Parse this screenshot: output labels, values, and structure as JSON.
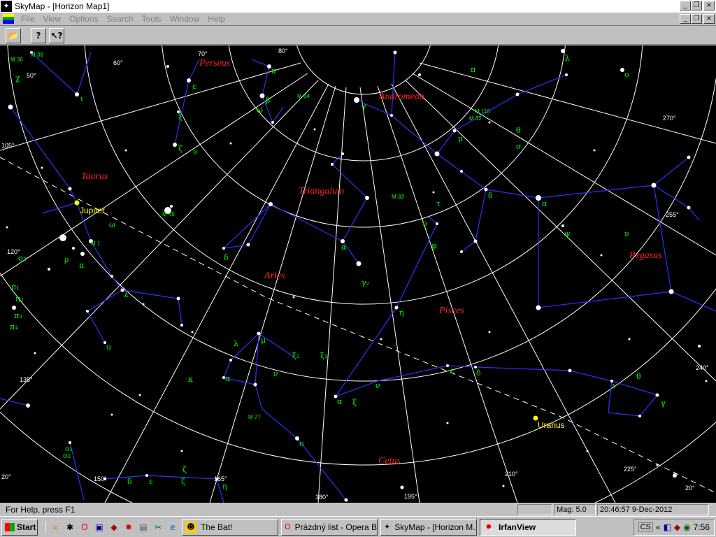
{
  "window": {
    "title": "SkyMap - [Horizon Map1]",
    "minimize": "_",
    "restore": "❐",
    "close": "×",
    "doc_minimize": "_",
    "doc_restore": "❐",
    "doc_close": "×"
  },
  "menu": {
    "items": [
      "File",
      "View",
      "Options",
      "Search",
      "Tools",
      "Window",
      "Help"
    ]
  },
  "toolbar": {
    "open_glyph": "📂",
    "help_glyph": "?",
    "context_help_glyph": "↖?"
  },
  "map": {
    "constellations": [
      "Perseus",
      "Andromeda",
      "Taurus",
      "Triangulum",
      "Aries",
      "Pisces",
      "Pegasus",
      "Cetus"
    ],
    "planets": [
      "Jupiter",
      "Uranus"
    ],
    "degree_labels": [
      "70°",
      "80°",
      "60°",
      "50°",
      "105°",
      "270°",
      "255°",
      "120°",
      "135°",
      "240°",
      "150°",
      "165°",
      "180°",
      "195°",
      "210°",
      "225°",
      "20°",
      "20°"
    ],
    "greek_labels": [
      "χ",
      "ι",
      "ε",
      "ξ",
      "ζ",
      "ο",
      "κ",
      "β",
      "ω",
      "γ",
      "π",
      "θ",
      "σ",
      "μ",
      "δ",
      "α",
      "λ",
      "ν",
      "τ",
      "φ",
      "υ",
      "η",
      "ψ",
      "ι",
      "ο",
      "θ",
      "γ",
      "ε",
      "δ",
      "ν",
      "ξ",
      "ζ",
      "ρ",
      "π",
      "σ₂",
      "α",
      "ν",
      "ξ₂",
      "ξ₁",
      "κ",
      "δ",
      "λ",
      "μ",
      "ο",
      "α",
      "π₁",
      "π₂",
      "π₃",
      "π₄",
      "ο₁",
      "ο₂",
      "γ₂",
      "ω",
      "α",
      "υ",
      "δ",
      "ε",
      "ζ",
      "η",
      "λ"
    ],
    "messier": [
      "M 36",
      "M 38",
      "M 34",
      "M 110",
      "M 32",
      "M 33",
      "M 45",
      "M 1",
      "M 77"
    ]
  },
  "status": {
    "help": "For Help, press F1",
    "blank": "",
    "mag": "Mag: 5.0",
    "datetime": "20:46:57 9-Dec-2012"
  },
  "taskbar": {
    "start": "Start",
    "tasks": [
      "The Bat!",
      "Prázdný list - Opera B...",
      "SkyMap - [Horizon M...",
      "IrfanView"
    ],
    "tray_cs": "CS",
    "tray_chevron": "«",
    "clock": "7:56"
  },
  "colors": {
    "sky": "#000000",
    "grid": "#ffffff",
    "constellation_lines": "#0000ff",
    "constellation_names": "#ff2020",
    "greek": "#00ff00",
    "planets": "#ffff00"
  }
}
